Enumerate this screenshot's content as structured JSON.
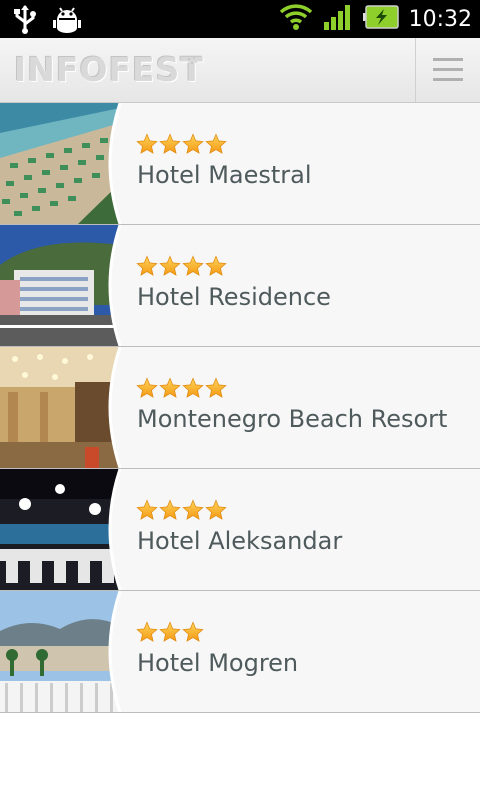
{
  "status_bar": {
    "time": "10:32",
    "icons": [
      "usb-icon",
      "debug-icon",
      "wifi-icon",
      "signal-icon",
      "battery-charging-icon"
    ]
  },
  "header": {
    "logo": "INFOFEST",
    "menu_icon": "menu-icon"
  },
  "hotels": [
    {
      "name": "Hotel Maestral",
      "stars": 4,
      "thumb": "beach"
    },
    {
      "name": "Hotel Residence",
      "stars": 4,
      "thumb": "building"
    },
    {
      "name": "Montenegro Beach Resort",
      "stars": 4,
      "thumb": "lobby"
    },
    {
      "name": "Hotel Aleksandar",
      "stars": 4,
      "thumb": "restaurant"
    },
    {
      "name": "Hotel Mogren",
      "stars": 3,
      "thumb": "terrace"
    }
  ],
  "colors": {
    "star": "#f5a623",
    "text": "#4f5a5c",
    "row_bg": "#f7f7f7"
  }
}
